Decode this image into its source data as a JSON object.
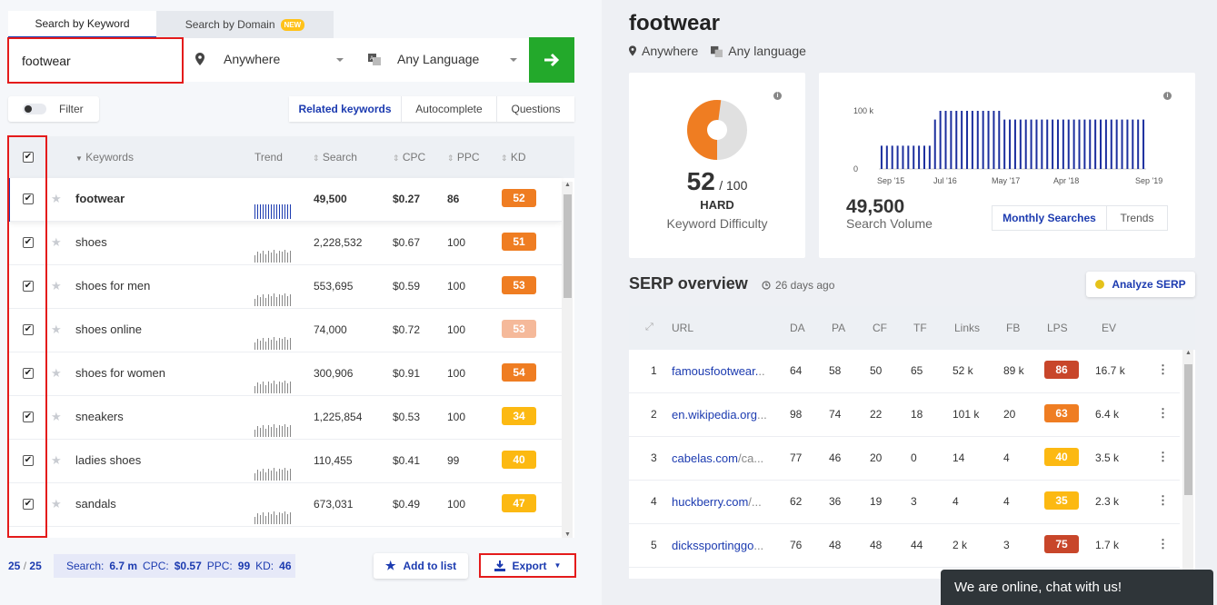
{
  "tabs": {
    "keyword": "Search by Keyword",
    "domain": "Search by Domain",
    "new_badge": "NEW"
  },
  "search": {
    "value": "footwear",
    "location": "Anywhere",
    "language": "Any Language",
    "go_icon": "arrow-right-icon"
  },
  "filter": {
    "label": "Filter"
  },
  "segments": {
    "related": "Related keywords",
    "autocomplete": "Autocomplete",
    "questions": "Questions"
  },
  "table": {
    "headers": {
      "keywords": "Keywords",
      "trend": "Trend",
      "search": "Search",
      "cpc": "CPC",
      "ppc": "PPC",
      "kd": "KD"
    },
    "rows": [
      {
        "keyword": "footwear",
        "search": "49,500",
        "cpc": "$0.27",
        "ppc": "86",
        "kd": "52",
        "kd_color": "#ef7d22",
        "selected": true
      },
      {
        "keyword": "shoes",
        "search": "2,228,532",
        "cpc": "$0.67",
        "ppc": "100",
        "kd": "51",
        "kd_color": "#ef7d22"
      },
      {
        "keyword": "shoes for men",
        "search": "553,695",
        "cpc": "$0.59",
        "ppc": "100",
        "kd": "53",
        "kd_color": "#ef7d22"
      },
      {
        "keyword": "shoes online",
        "search": "74,000",
        "cpc": "$0.72",
        "ppc": "100",
        "kd": "53",
        "kd_color": "#f5b99a"
      },
      {
        "keyword": "shoes for women",
        "search": "300,906",
        "cpc": "$0.91",
        "ppc": "100",
        "kd": "54",
        "kd_color": "#ef7d22"
      },
      {
        "keyword": "sneakers",
        "search": "1,225,854",
        "cpc": "$0.53",
        "ppc": "100",
        "kd": "34",
        "kd_color": "#fcb912"
      },
      {
        "keyword": "ladies shoes",
        "search": "110,455",
        "cpc": "$0.41",
        "ppc": "99",
        "kd": "40",
        "kd_color": "#fcb912"
      },
      {
        "keyword": "sandals",
        "search": "673,031",
        "cpc": "$0.49",
        "ppc": "100",
        "kd": "47",
        "kd_color": "#fcb912"
      }
    ]
  },
  "footer": {
    "count_selected": "25",
    "count_sep": "/",
    "count_total": "25",
    "search_label": "Search:",
    "search_val": "6.7 m",
    "cpc_label": "CPC:",
    "cpc_val": "$0.57",
    "ppc_label": "PPC:",
    "ppc_val": "99",
    "kd_label": "KD:",
    "kd_val": "46",
    "add_to_list": "Add to list",
    "export": "Export"
  },
  "detail": {
    "title": "footwear",
    "location": "Anywhere",
    "language": "Any language",
    "kd_value": "52",
    "kd_max": "/ 100",
    "kd_level": "HARD",
    "kd_label": "Keyword Difficulty",
    "kd_fraction": 0.52,
    "volume_value": "49,500",
    "volume_label": "Search Volume",
    "chart_tabs": {
      "monthly": "Monthly Searches",
      "trends": "Trends"
    }
  },
  "chart_data": {
    "type": "bar",
    "ylabels": [
      "100 k",
      "0"
    ],
    "ylim": [
      0,
      100
    ],
    "xlabels": [
      "Sep '15",
      "Jul '16",
      "May '17",
      "Apr '18",
      "Sep '19"
    ],
    "values": [
      40,
      40,
      40,
      40,
      40,
      40,
      40,
      40,
      40,
      40,
      85,
      100,
      100,
      100,
      100,
      100,
      100,
      100,
      100,
      100,
      100,
      100,
      100,
      85,
      85,
      85,
      85,
      85,
      85,
      85,
      85,
      85,
      85,
      85,
      85,
      85,
      85,
      85,
      85,
      85,
      85,
      85,
      85,
      85,
      85,
      85,
      85,
      85,
      85,
      85
    ],
    "color": "#1c2f9e"
  },
  "serp": {
    "title": "SERP overview",
    "age": "26 days ago",
    "analyze": "Analyze SERP",
    "headers": {
      "url": "URL",
      "da": "DA",
      "pa": "PA",
      "cf": "CF",
      "tf": "TF",
      "links": "Links",
      "fb": "FB",
      "lps": "LPS",
      "ev": "EV"
    },
    "rows": [
      {
        "n": "1",
        "domain": "famousfootwear.",
        "path": "..",
        "da": "64",
        "pa": "58",
        "cf": "50",
        "tf": "65",
        "links": "52 k",
        "fb": "89 k",
        "lps": "86",
        "lps_color": "#c8462a",
        "ev": "16.7 k"
      },
      {
        "n": "2",
        "domain": "en.wikipedia.org",
        "path": "...",
        "da": "98",
        "pa": "74",
        "cf": "22",
        "tf": "18",
        "links": "101 k",
        "fb": "20",
        "lps": "63",
        "lps_color": "#ef7d22",
        "ev": "6.4 k"
      },
      {
        "n": "3",
        "domain": "cabelas.com",
        "path": "/ca...",
        "da": "77",
        "pa": "46",
        "cf": "20",
        "tf": "0",
        "links": "14",
        "fb": "4",
        "lps": "40",
        "lps_color": "#fcb912",
        "ev": "3.5 k"
      },
      {
        "n": "4",
        "domain": "huckberry.com",
        "path": "/...",
        "da": "62",
        "pa": "36",
        "cf": "19",
        "tf": "3",
        "links": "4",
        "fb": "4",
        "lps": "35",
        "lps_color": "#fcb912",
        "ev": "2.3 k"
      },
      {
        "n": "5",
        "domain": "dickssportinggo",
        "path": "...",
        "da": "76",
        "pa": "48",
        "cf": "48",
        "tf": "44",
        "links": "2 k",
        "fb": "3",
        "lps": "75",
        "lps_color": "#c8462a",
        "ev": "1.7 k"
      }
    ]
  },
  "chat": {
    "text": "We are online, chat with us!"
  }
}
